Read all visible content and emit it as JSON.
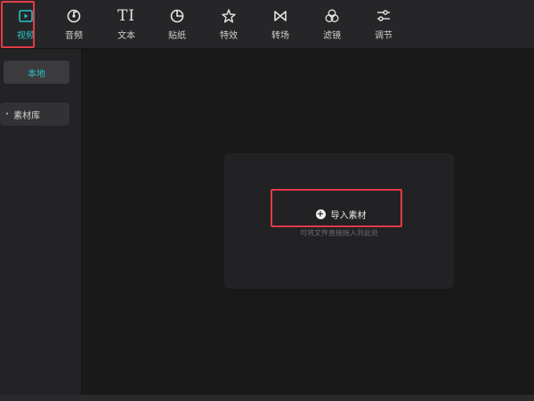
{
  "toolbar": {
    "items": [
      {
        "key": "video",
        "label": "视频",
        "icon": "play-square-icon",
        "active": true
      },
      {
        "key": "audio",
        "label": "音频",
        "icon": "music-disc-icon",
        "active": false
      },
      {
        "key": "text",
        "label": "文本",
        "icon": "text-ti-icon",
        "icon_text": "TI",
        "active": false
      },
      {
        "key": "sticker",
        "label": "贴纸",
        "icon": "sticker-icon",
        "active": false
      },
      {
        "key": "effects",
        "label": "特效",
        "icon": "sparkle-star-icon",
        "active": false
      },
      {
        "key": "transition",
        "label": "转场",
        "icon": "bowtie-transition-icon",
        "active": false
      },
      {
        "key": "filter",
        "label": "滤镜",
        "icon": "three-circles-filter-icon",
        "active": false
      },
      {
        "key": "adjust",
        "label": "调节",
        "icon": "sliders-icon",
        "active": false
      }
    ]
  },
  "sidebar": {
    "local_label": "本地",
    "library_label": "素材库",
    "library_bullet": "•"
  },
  "main": {
    "import_label": "导入素材",
    "import_icon": "plus-circle-icon",
    "drop_hint": "可将文件直接拖入到此处"
  },
  "colors": {
    "accent": "#29c4c7",
    "highlight": "#e23b45"
  }
}
